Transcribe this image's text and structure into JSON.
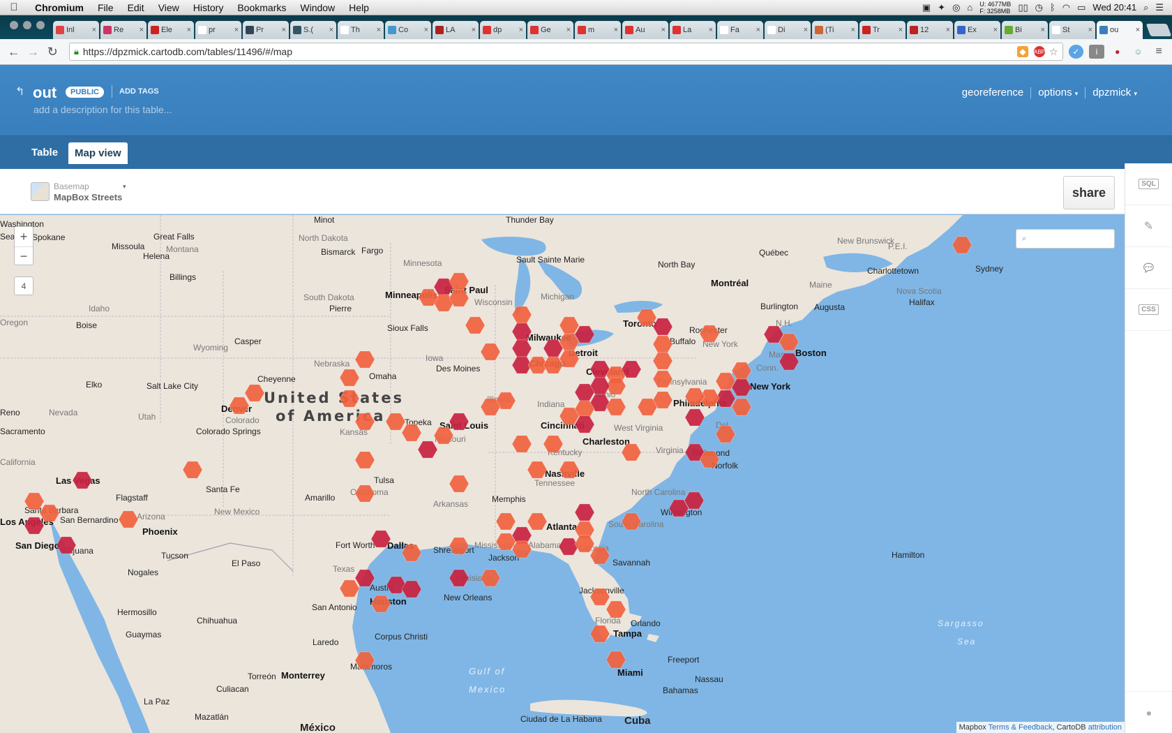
{
  "menubar": {
    "apple": "",
    "app": "Chromium",
    "items": [
      "File",
      "Edit",
      "View",
      "History",
      "Bookmarks",
      "Window",
      "Help"
    ],
    "mem_u": "U: 4677MB",
    "mem_f": "F: 3258MB",
    "clock": "Wed 20:41"
  },
  "tabs": [
    {
      "title": "Inl",
      "color": "#d44"
    },
    {
      "title": "Re",
      "color": "#c36"
    },
    {
      "title": "Ele",
      "color": "#c22"
    },
    {
      "title": "pr",
      "color": "#fff"
    },
    {
      "title": "Pr",
      "color": "#345"
    },
    {
      "title": "S.(",
      "color": "#356"
    },
    {
      "title": "Th",
      "color": "#fff"
    },
    {
      "title": "Co",
      "color": "#49c"
    },
    {
      "title": "LA",
      "color": "#a22"
    },
    {
      "title": "dp",
      "color": "#d33"
    },
    {
      "title": "Ge",
      "color": "#d33"
    },
    {
      "title": "m",
      "color": "#d33"
    },
    {
      "title": "Au",
      "color": "#d33"
    },
    {
      "title": "La",
      "color": "#d33"
    },
    {
      "title": "Fa",
      "color": "#fff"
    },
    {
      "title": "Di",
      "color": "#fff"
    },
    {
      "title": "(Ti",
      "color": "#c63"
    },
    {
      "title": "Tr",
      "color": "#c22"
    },
    {
      "title": "12",
      "color": "#b22"
    },
    {
      "title": "Ex",
      "color": "#36c"
    },
    {
      "title": "Bi",
      "color": "#6a3"
    },
    {
      "title": "St",
      "color": "#fff"
    },
    {
      "title": "ou",
      "color": "#3a7fbd",
      "active": true
    }
  ],
  "omnibox": {
    "url": "https://dpzmick.cartodb.com/tables/11496/#/map"
  },
  "cartodb": {
    "table_name": "out",
    "privacy": "PUBLIC",
    "add_tags": "ADD TAGS",
    "description_placeholder": "add a description for this table...",
    "links": [
      "georeference",
      "options",
      "dpzmick"
    ],
    "view_tabs": {
      "table": "Table",
      "map": "Map view"
    },
    "basemap_label": "Basemap",
    "basemap_name": "MapBox Streets",
    "share": "share",
    "tools": [
      "SQL",
      "edit",
      "comment",
      "CSS"
    ]
  },
  "map": {
    "zoom_in": "+",
    "zoom_out": "−",
    "zoom_level": "4",
    "attribution_prefix": "Mapbox",
    "attribution_link1": "Terms & Feedback",
    "attribution_mid": ", CartoDB",
    "attribution_link2": "attribution",
    "hex_colors": {
      "light": "#f0623e",
      "dark": "#c8223f"
    },
    "labels": {
      "big": [
        "United States",
        "of America"
      ],
      "states": [
        "Montana",
        "North Dakota",
        "South Dakota",
        "Minnesota",
        "Wisconsin",
        "Michigan",
        "Iowa",
        "Nebraska",
        "Wyoming",
        "Idaho",
        "Nevada",
        "Utah",
        "Colorado",
        "Kansas",
        "Missouri",
        "Illinois",
        "Indiana",
        "Ohio",
        "Pennsylvania",
        "New York",
        "West Virginia",
        "Virginia",
        "Kentucky",
        "Tennessee",
        "North Carolina",
        "South Carolina",
        "Georgia",
        "Alabama",
        "Mississippi",
        "Louisiana",
        "Arkansas",
        "Oklahoma",
        "Texas",
        "New Mexico",
        "Arizona",
        "California",
        "Florida",
        "Maine",
        "Nova Scotia",
        "New Brunswick",
        "P.E.I.",
        "Conn.",
        "Mass.",
        "N.H.",
        "Del.",
        "Oregon"
      ],
      "cities": [
        "Minot",
        "Missoula",
        "Great Falls",
        "Helena",
        "Bismarck",
        "Fargo",
        "Billings",
        "Sioux Falls",
        "Pierre",
        "Boise",
        "Casper",
        "Cheyenne",
        "Elko",
        "Salt Lake City",
        "Denver",
        "Colorado Springs",
        "Reno",
        "Sacramento",
        "Las Vegas",
        "Flagstaff",
        "Santa Fe",
        "Amarillo",
        "Tulsa",
        "Topeka",
        "Omaha",
        "Des Moines",
        "Memphis",
        "Fort Worth",
        "Austin",
        "San Antonio",
        "Corpus Christi",
        "Shreveport",
        "Jackson",
        "New Orleans",
        "Jacksonville",
        "Savannah",
        "Atlanta",
        "Charleston",
        "Cincinnati",
        "Cleveland",
        "Buffalo",
        "Rochester",
        "Burlington",
        "Augusta",
        "Halifax",
        "Charlottetown",
        "Sydney",
        "Québec",
        "Montréal",
        "Toronto",
        "Sault Sainte Marie",
        "North Bay",
        "Thunder Bay",
        "Milwaukee",
        "Chicago",
        "Detroit",
        "Saint Paul",
        "Minneapolis",
        "Saint Louis",
        "Nashville",
        "Richmond",
        "Norfolk",
        "Wilmington",
        "Tampa",
        "Orlando",
        "Miami",
        "Freeport",
        "Nassau",
        "Bahamas",
        "Hamilton",
        "Tucson",
        "El Paso",
        "Nogales",
        "Hermosillo",
        "Chihuahua",
        "Guaymas",
        "Culiacan",
        "La Paz",
        "Mazatlán",
        "Torreón",
        "Monterrey",
        "Laredo",
        "Matamoros",
        "Tijuana",
        "San Diego",
        "San Bernardino",
        "Santa Barbara",
        "Los Angeles",
        "Phoenix",
        "Dallas",
        "Houston",
        "Boston",
        "New York",
        "Philadelphia",
        "Washington",
        "Spokane",
        "Seattle",
        "Ciudad de La Habana",
        "Cuba",
        "México"
      ],
      "water": [
        "Gulf of",
        "Mexico",
        "Sargasso",
        "Sea"
      ]
    }
  }
}
